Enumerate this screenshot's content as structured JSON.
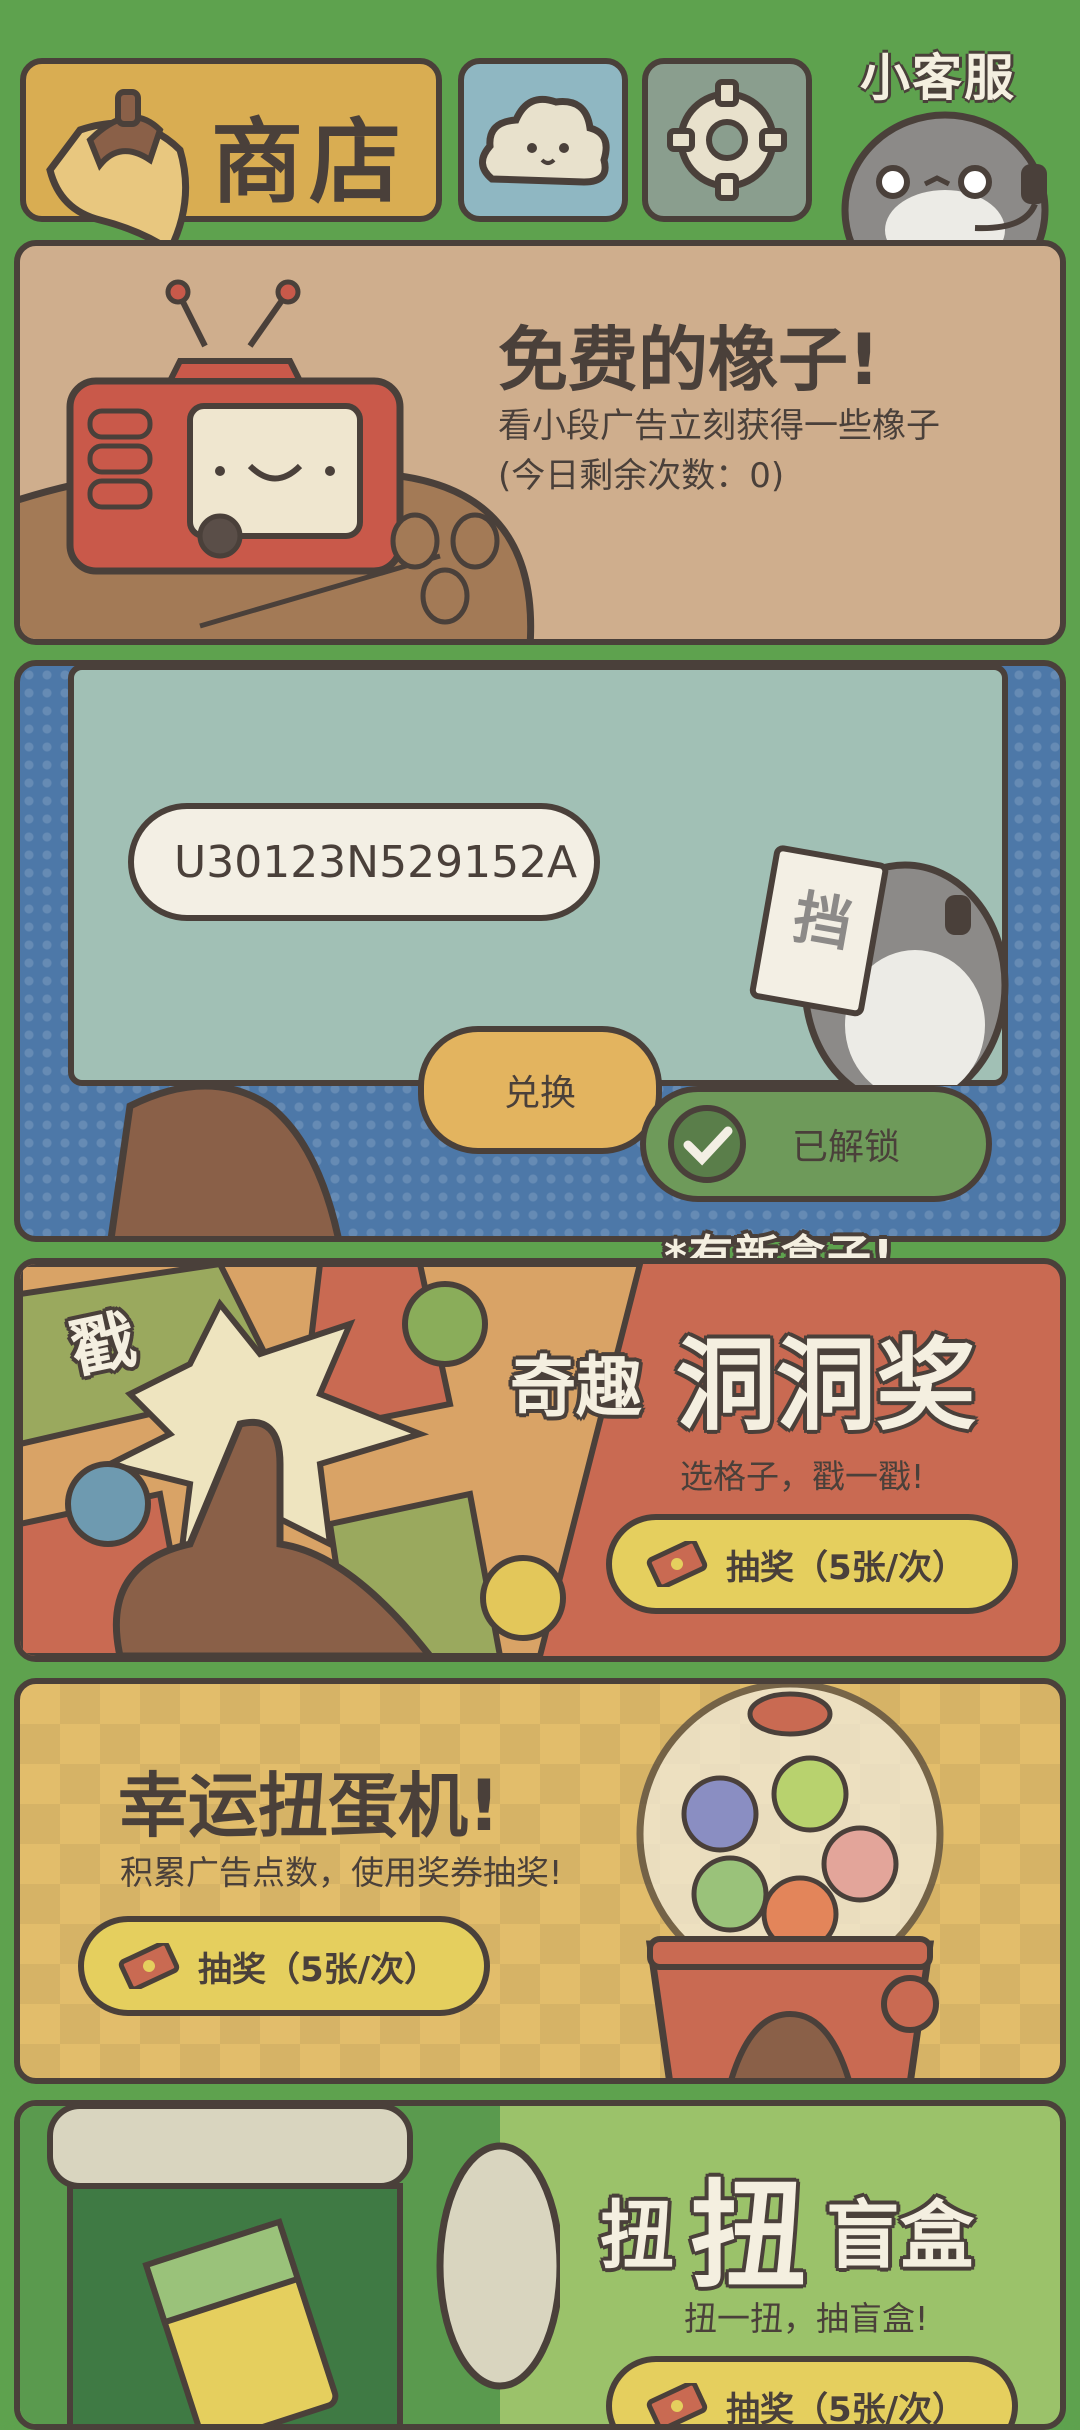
{
  "topbar": {
    "shop_label": "商店",
    "customer_service_label": "小客服"
  },
  "free_acorns": {
    "title": "免费的橡子!",
    "desc": "看小段广告立刻获得一些橡子",
    "remaining": "(今日剩余次数：0)"
  },
  "redeem": {
    "code_value": "U30123N529152A",
    "redeem_label": "兑换",
    "unlocked_label": "已解锁",
    "sign_text": "挡"
  },
  "holes_prize": {
    "badge": "*有新盒子!",
    "title_small": "奇趣",
    "title_large": "洞洞奖",
    "poke_text": "戳",
    "subtitle": "选格子，戳一戳!",
    "button_label": "抽奖（5张/次）"
  },
  "gacha": {
    "title": "幸运扭蛋机!",
    "subtitle": "积累广告点数，使用奖券抽奖!",
    "button_label": "抽奖（5张/次）"
  },
  "blind_box": {
    "title_small": "扭",
    "title_large": "扭",
    "title_end": "盲盒",
    "subtitle": "扭一扭，抽盲盒!",
    "button_label": "抽奖（5张/次）"
  },
  "colors": {
    "background": "#5ea24e",
    "outline": "#4a403a",
    "button_yellow": "#e5cf5e",
    "button_orange": "#e3b45f",
    "unlocked_green": "#6e9a5a"
  }
}
